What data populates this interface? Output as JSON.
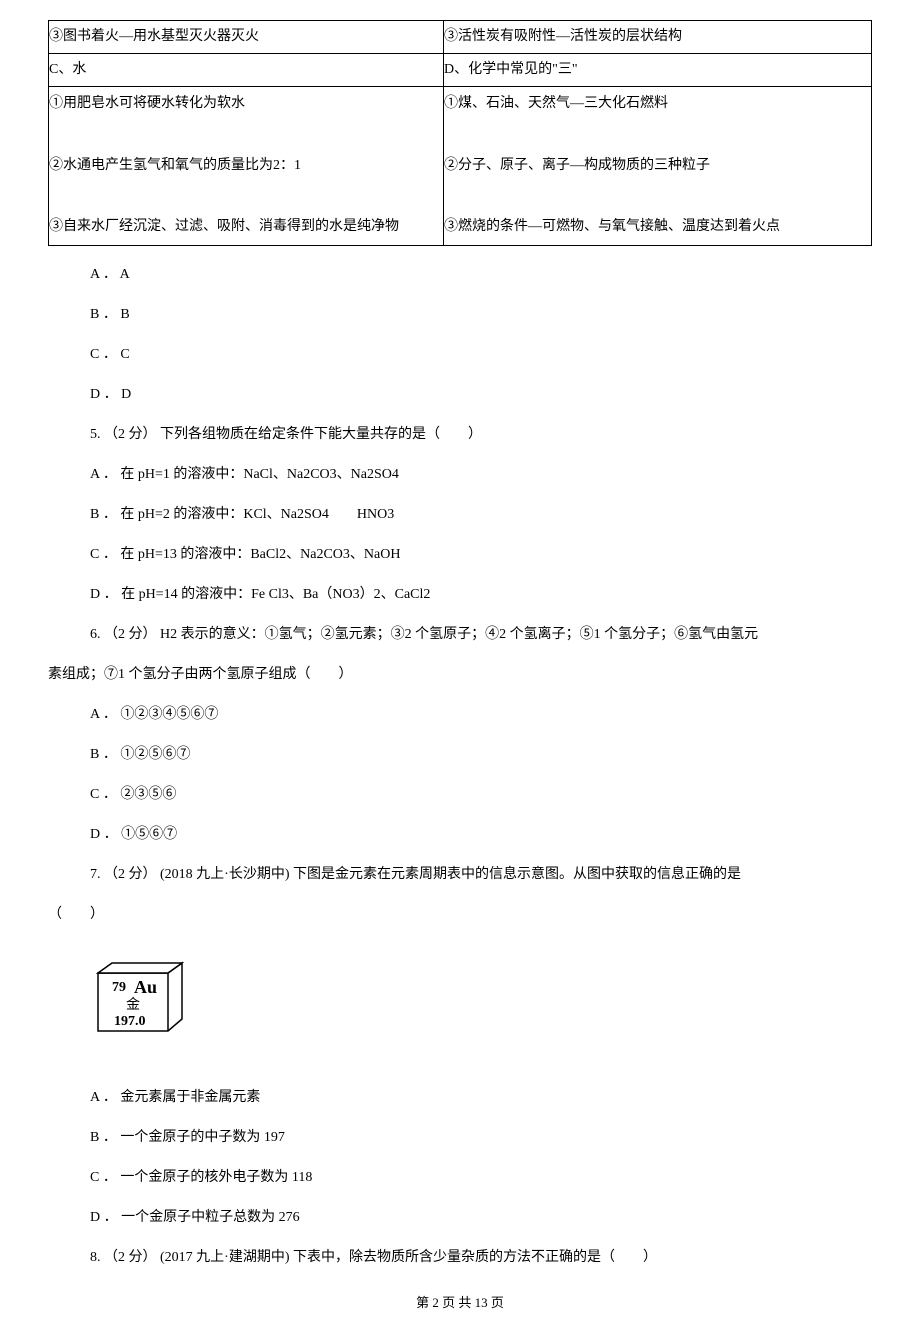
{
  "table": {
    "r1c1": "③图书着火—用水基型灭火器灭火",
    "r1c2": "③活性炭有吸附性—活性炭的层状结构",
    "r2c1": "C、水",
    "r2c2": "D、化学中常见的\"三\"",
    "r3c1": "①用肥皂水可将硬水转化为软水\n\n②水通电产生氢气和氧气的质量比为2：1\n\n③自来水厂经沉淀、过滤、吸附、消毒得到的水是纯净物",
    "r3c2": "①煤、石油、天然气—三大化石燃料\n\n②分子、原子、离子—构成物质的三种粒子\n\n③燃烧的条件—可燃物、与氧气接触、温度达到着火点"
  },
  "options_abcd": {
    "a": "A ． A",
    "b": "B ． B",
    "c": "C ． C",
    "d": "D ． D"
  },
  "q5": {
    "stem": "5. （2 分） 下列各组物质在给定条件下能大量共存的是（　　）",
    "a": "A ． 在 pH=1 的溶液中：NaCl、Na2CO3、Na2SO4",
    "b": "B ． 在 pH=2 的溶液中：KCl、Na2SO4　　HNO3",
    "c": "C ． 在 pH=13 的溶液中：BaCl2、Na2CO3、NaOH",
    "d": "D ． 在 pH=14 的溶液中：Fe Cl3、Ba（NO3）2、CaCl2"
  },
  "q6": {
    "stem_line1": "6. （2 分） H2 表示的意义：①氢气；②氢元素；③2 个氢原子；④2 个氢离子；⑤1 个氢分子；⑥氢气由氢元",
    "stem_line2": "素组成；⑦1 个氢分子由两个氢原子组成（　　）",
    "a": "A ． ①②③④⑤⑥⑦",
    "b": "B ． ①②⑤⑥⑦",
    "c": "C ． ②③⑤⑥",
    "d": "D ． ①⑤⑥⑦"
  },
  "q7": {
    "stem_line1": "7. （2 分） (2018 九上·长沙期中) 下图是金元素在元素周期表中的信息示意图。从图中获取的信息正确的是",
    "stem_line2": "（　　）",
    "element_number": "79",
    "element_symbol": "Au",
    "element_name": "金",
    "element_mass": "197.0",
    "a": "A ． 金元素属于非金属元素",
    "b": "B ． 一个金原子的中子数为 197",
    "c": "C ． 一个金原子的核外电子数为 118",
    "d": "D ． 一个金原子中粒子总数为 276"
  },
  "q8": {
    "stem": "8. （2 分） (2017 九上·建湖期中) 下表中，除去物质所含少量杂质的方法不正确的是（　　）"
  },
  "footer": "第 2 页 共 13 页"
}
